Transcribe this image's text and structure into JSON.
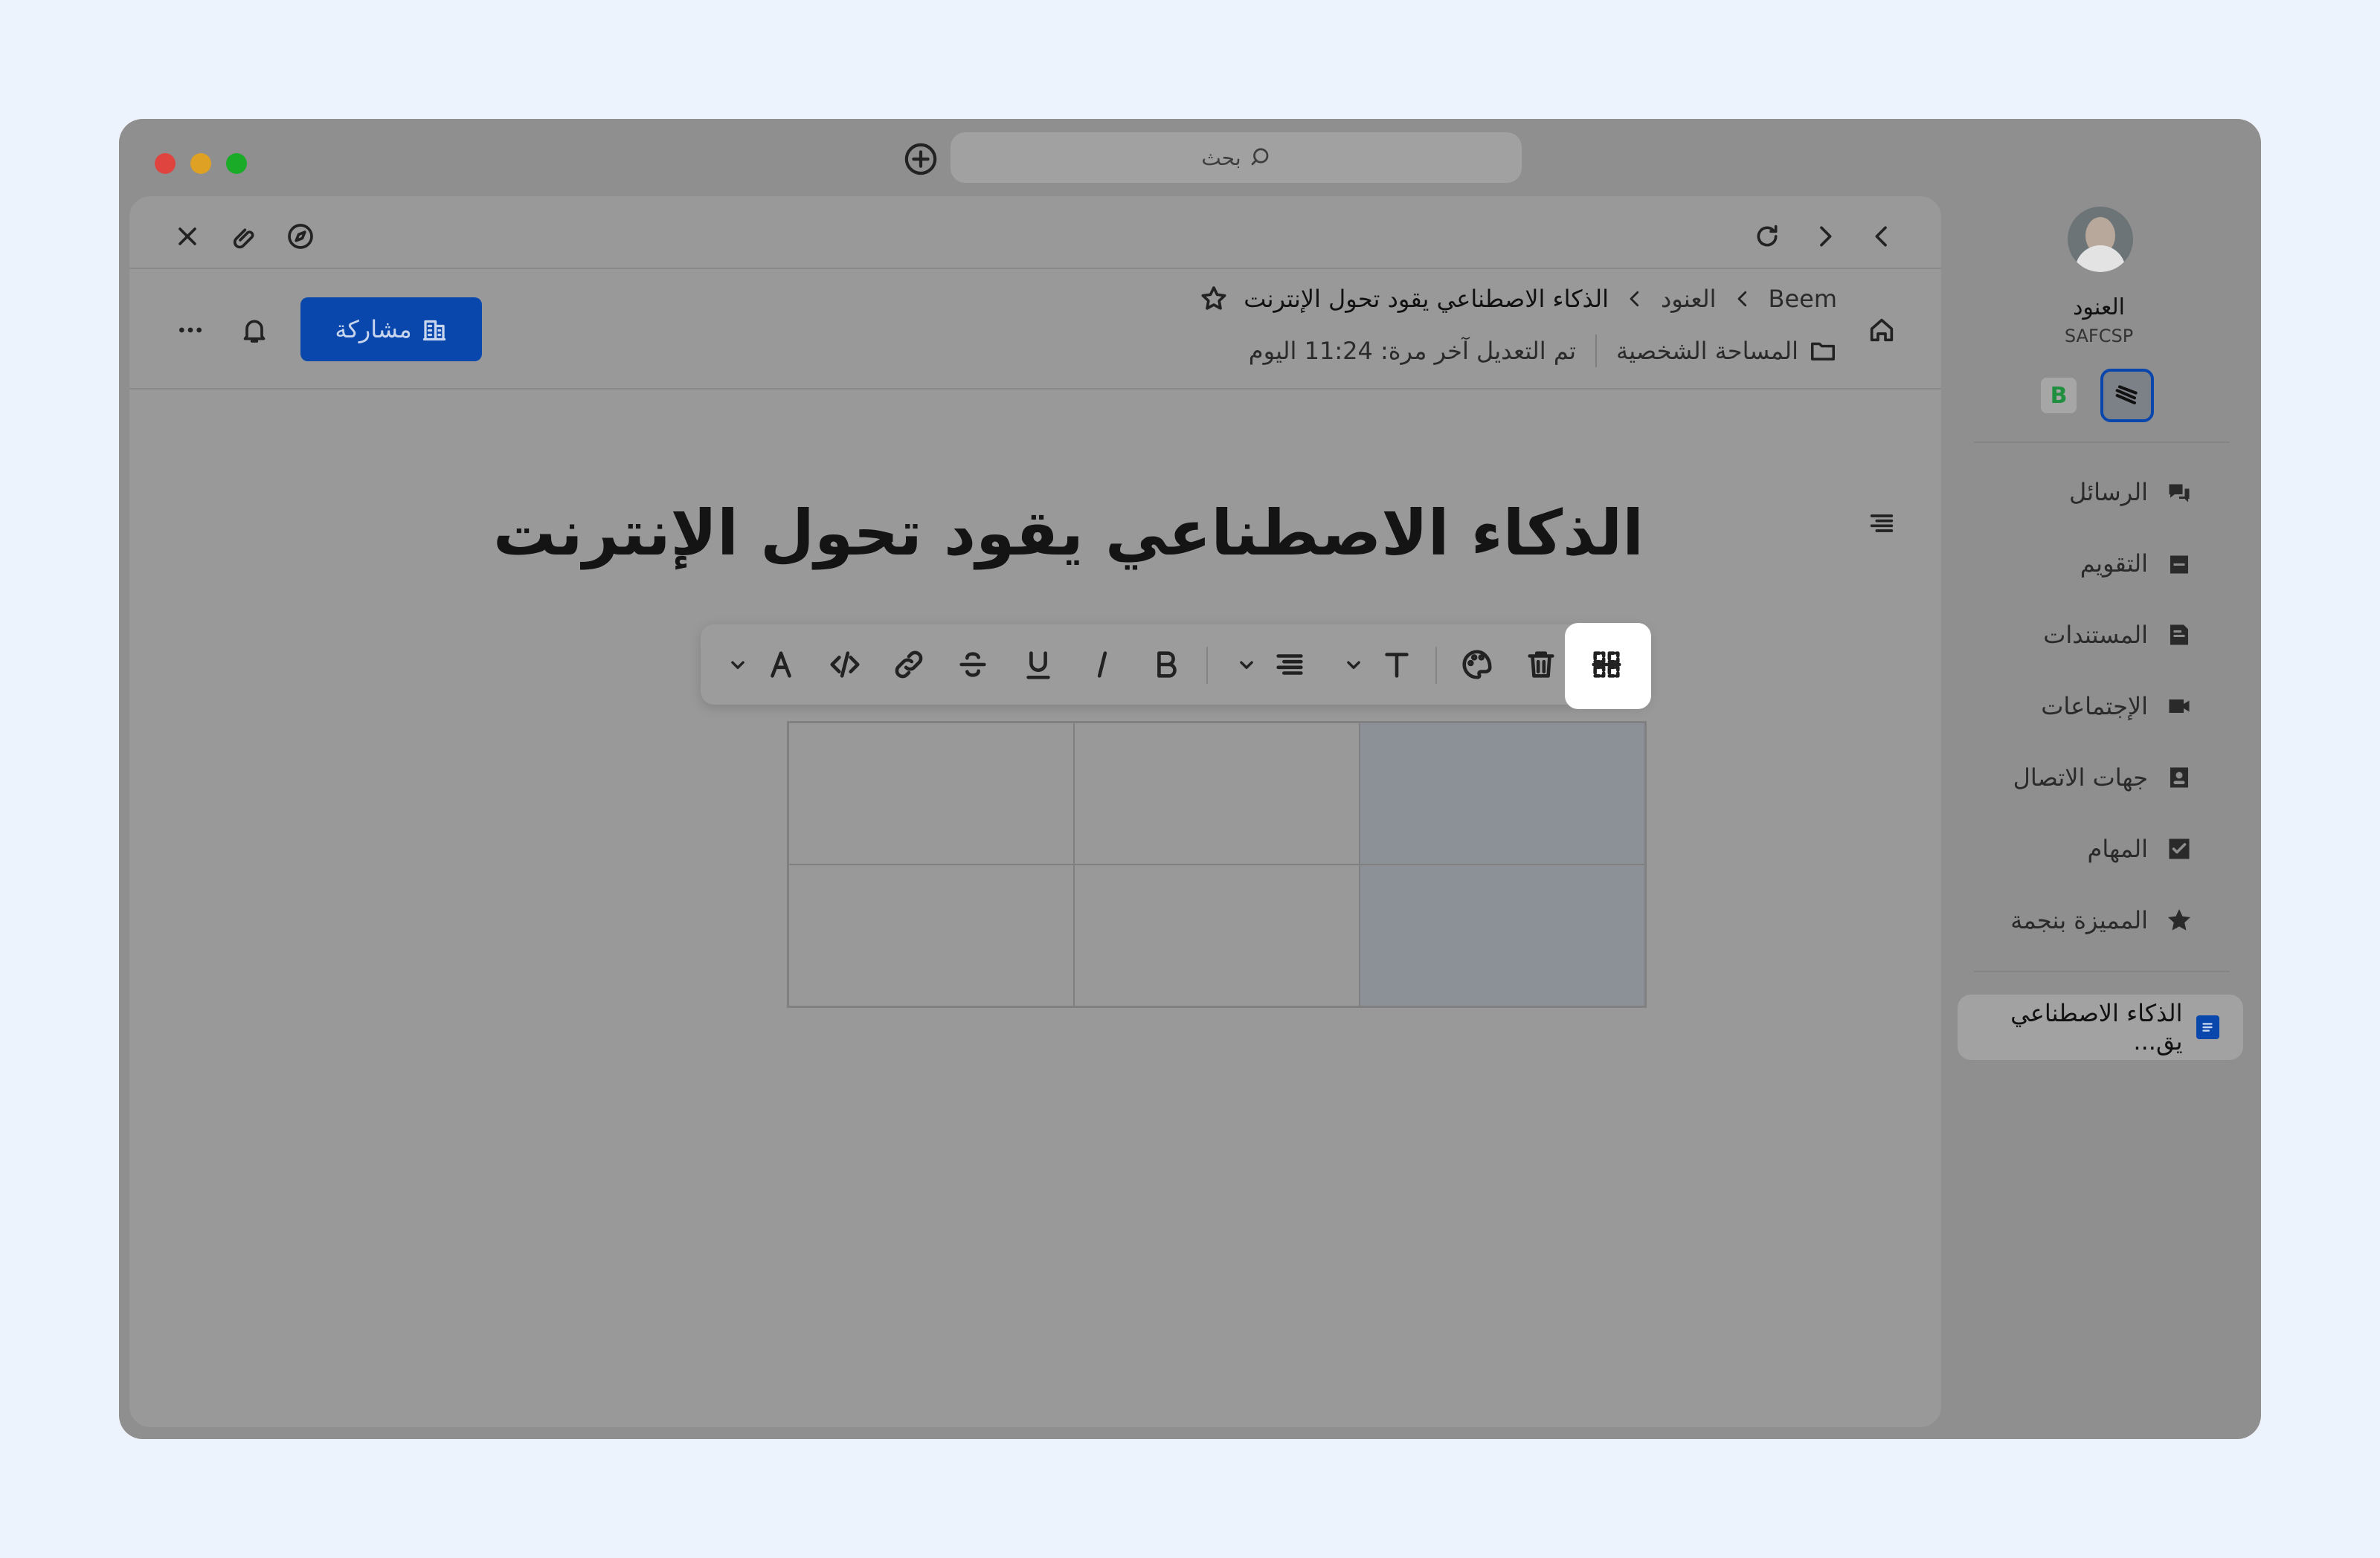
{
  "search": {
    "placeholder": "بحث"
  },
  "tab_bar": {
    "close_tooltip": "close",
    "icons": [
      "close-icon",
      "paperclip-icon",
      "compass-icon",
      "refresh-icon",
      "forward-icon",
      "back-icon"
    ]
  },
  "header": {
    "breadcrumb": [
      "Beem",
      "العنود",
      "الذكاء الاصطناعي يقود تحول الإنترنت"
    ],
    "location": "المساحة الشخصية",
    "last_edited": "تم التعديل آخر مرة: 11:24 اليوم",
    "share_label": "مشاركة"
  },
  "document": {
    "title": "الذكاء الاصطناعي يقود تحول الإنترنت"
  },
  "toolbar": {
    "buttons": [
      "font-color",
      "code",
      "link",
      "strikethrough",
      "underline",
      "italic",
      "bold",
      "align",
      "text-style",
      "palette",
      "delete",
      "fit-table"
    ]
  },
  "sidebar": {
    "user_name": "العنود",
    "user_org": "SAFCSP",
    "workspace_badge": "B",
    "items": [
      {
        "label": "الرسائل",
        "icon": "messages-icon"
      },
      {
        "label": "التقويم",
        "icon": "calendar-icon"
      },
      {
        "label": "المستندات",
        "icon": "documents-icon"
      },
      {
        "label": "الإجتماعات",
        "icon": "video-icon"
      },
      {
        "label": "جهات الاتصال",
        "icon": "contacts-icon"
      },
      {
        "label": "المهام",
        "icon": "tasks-icon"
      },
      {
        "label": "المميزة بنجمة",
        "icon": "star-icon"
      }
    ],
    "active_doc": "الذكاء الاصطناعي يق..."
  },
  "colors": {
    "accent": "#0a47ad",
    "close_dot": "#e0443e",
    "min_dot": "#dea123",
    "max_dot": "#1aab29"
  }
}
